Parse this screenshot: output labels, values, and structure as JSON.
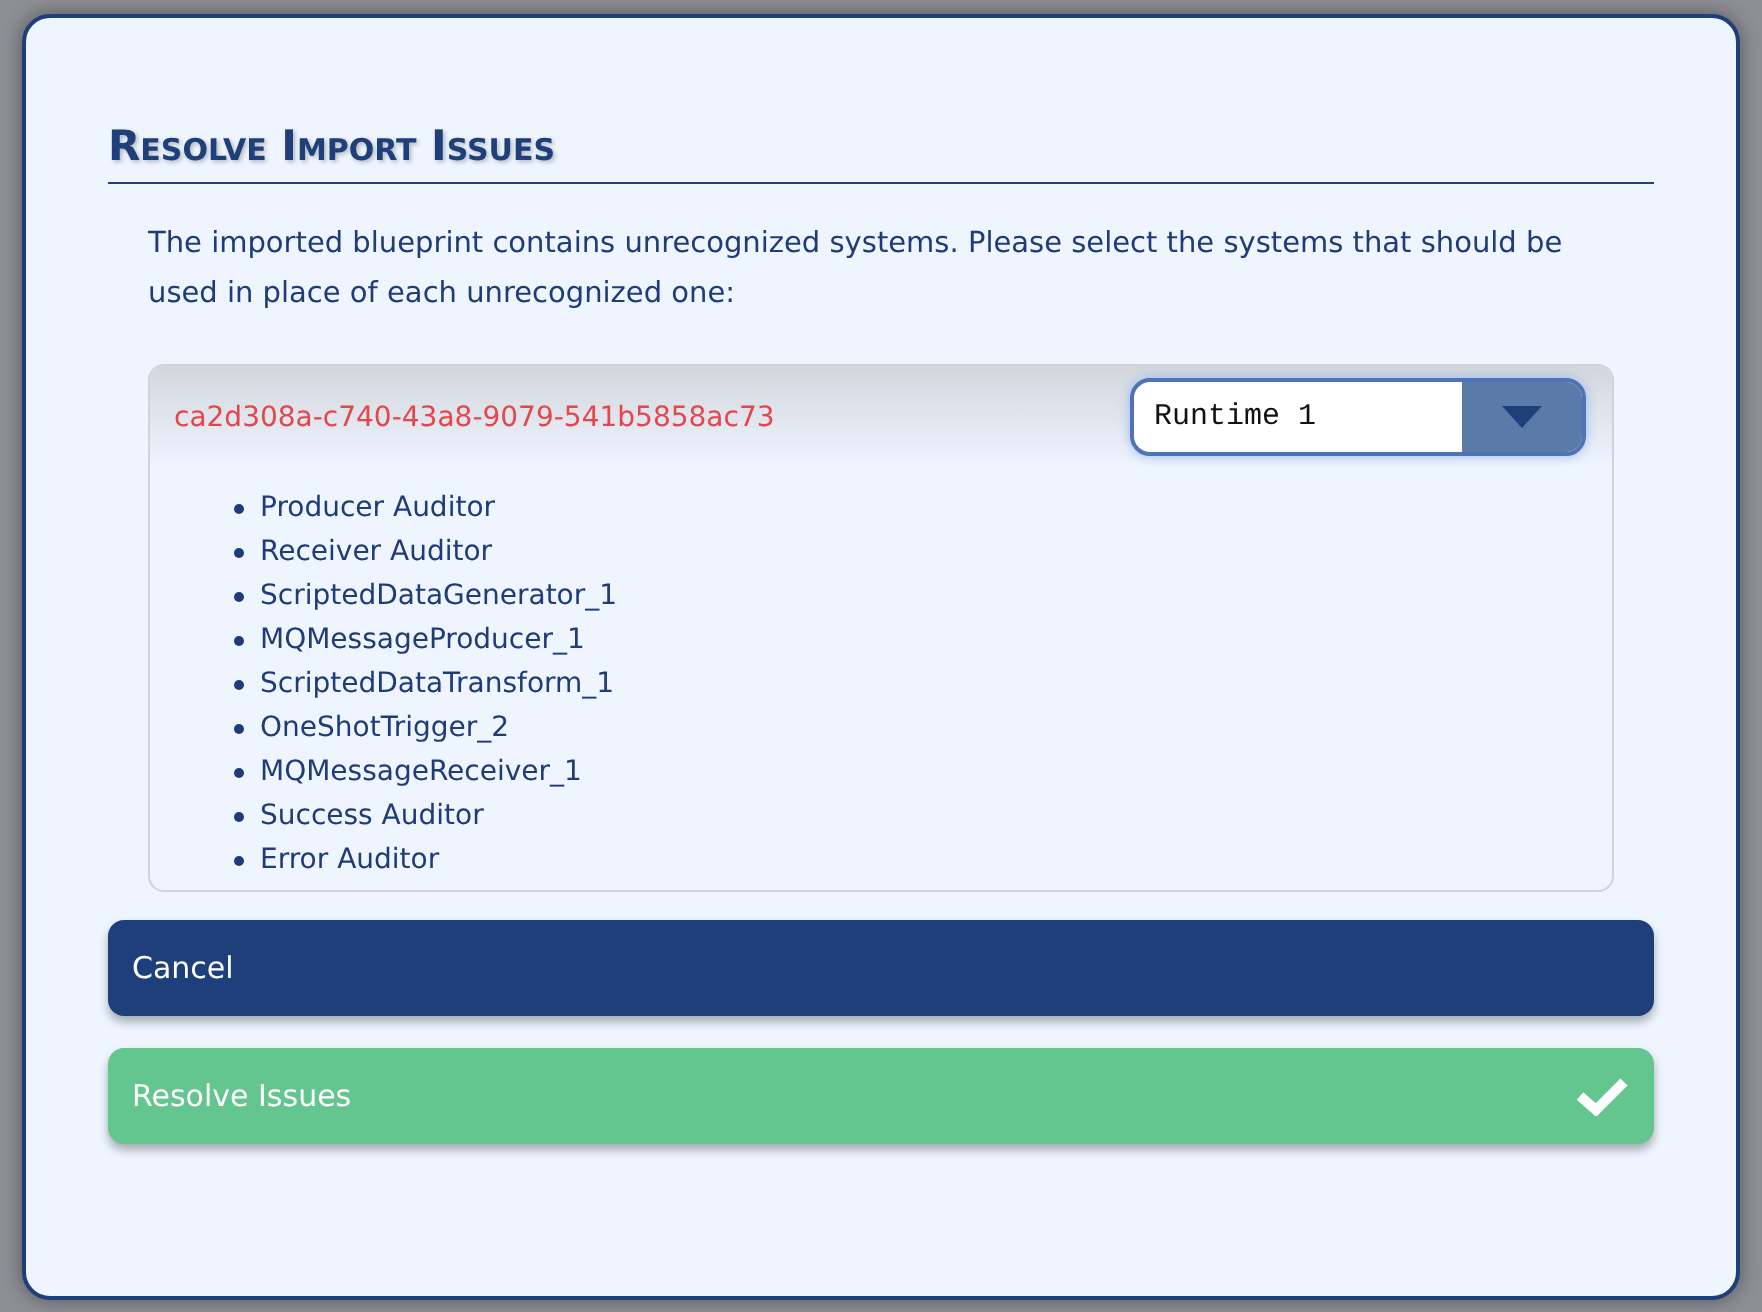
{
  "dialog": {
    "title": "Resolve Import Issues",
    "message": "The imported blueprint contains unrecognized systems. Please select the systems that should be used in place of each unrecognized one:",
    "issues": [
      {
        "id": "ca2d308a-c740-43a8-9079-541b5858ac73",
        "replacement": "Runtime 1",
        "systems": [
          "Producer Auditor",
          "Receiver Auditor",
          "ScriptedDataGenerator_1",
          "MQMessageProducer_1",
          "ScriptedDataTransform_1",
          "OneShotTrigger_2",
          "MQMessageReceiver_1",
          "Success Auditor",
          "Error Auditor"
        ]
      }
    ],
    "buttons": [
      {
        "label": "Cancel",
        "kind": "cancel"
      },
      {
        "label": "Resolve Issues",
        "kind": "confirm"
      }
    ]
  }
}
